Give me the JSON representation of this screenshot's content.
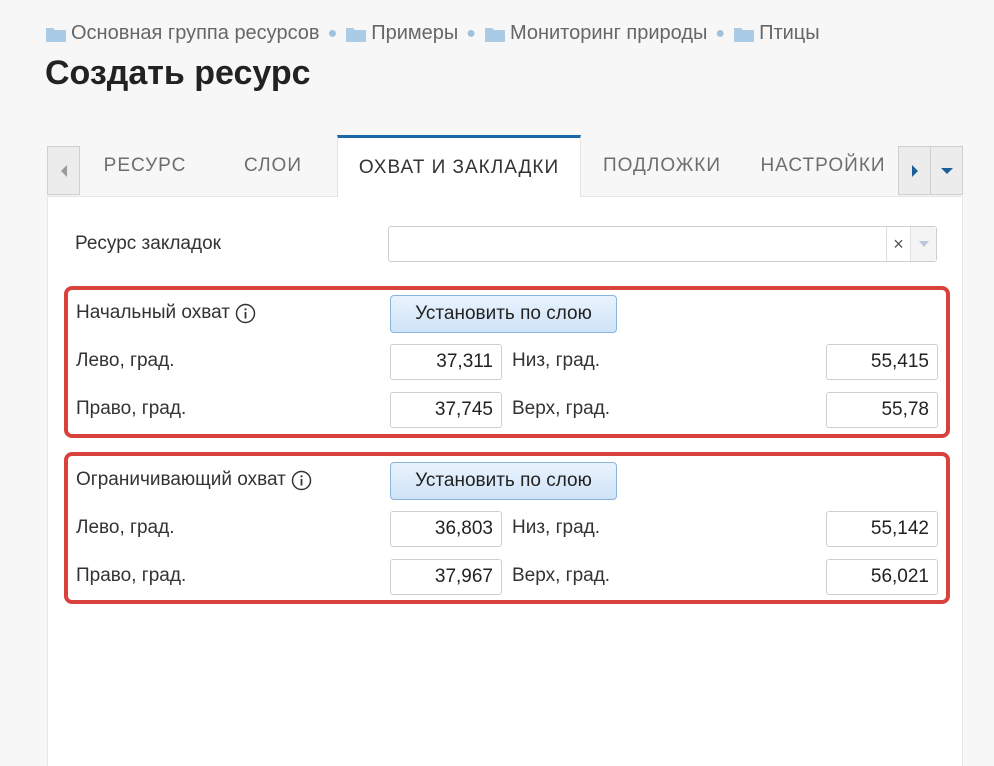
{
  "breadcrumb": [
    {
      "label": "Основная группа ресурсов"
    },
    {
      "label": "Примеры"
    },
    {
      "label": "Мониторинг природы"
    },
    {
      "label": "Птицы"
    }
  ],
  "page_title": "Создать ресурс",
  "tabs": [
    {
      "label": "РЕСУРС",
      "active": false
    },
    {
      "label": "СЛОИ",
      "active": false
    },
    {
      "label": "ОХВАТ И ЗАКЛАДКИ",
      "active": true
    },
    {
      "label": "ПОДЛОЖКИ",
      "active": false
    },
    {
      "label": "НАСТРОЙКИ",
      "active": false
    }
  ],
  "bookmark_resource": {
    "label": "Ресурс закладок",
    "value": "",
    "clear": "×"
  },
  "initial_extent": {
    "label": "Начальный охват",
    "button": "Установить по слою",
    "left_label": "Лево, град.",
    "left": "37,311",
    "right_label": "Право, град.",
    "right": "37,745",
    "bottom_label": "Низ, град.",
    "bottom": "55,415",
    "top_label": "Верх, град.",
    "top": "55,78"
  },
  "constraining_extent": {
    "label": "Ограничивающий охват",
    "button": "Установить по слою",
    "left_label": "Лево, град.",
    "left": "36,803",
    "right_label": "Право, град.",
    "right": "37,967",
    "bottom_label": "Низ, град.",
    "bottom": "55,142",
    "top_label": "Верх, град.",
    "top": "56,021"
  },
  "icons": {
    "folder": "folder-icon",
    "info": "info-icon",
    "tab_left": "chevron-left-icon",
    "tab_right": "chevron-right-icon",
    "tab_menu": "chevron-down-icon"
  },
  "colors": {
    "accent": "#1b68a8",
    "highlight_border": "#d9423c",
    "folder": "#a9cbe6"
  }
}
